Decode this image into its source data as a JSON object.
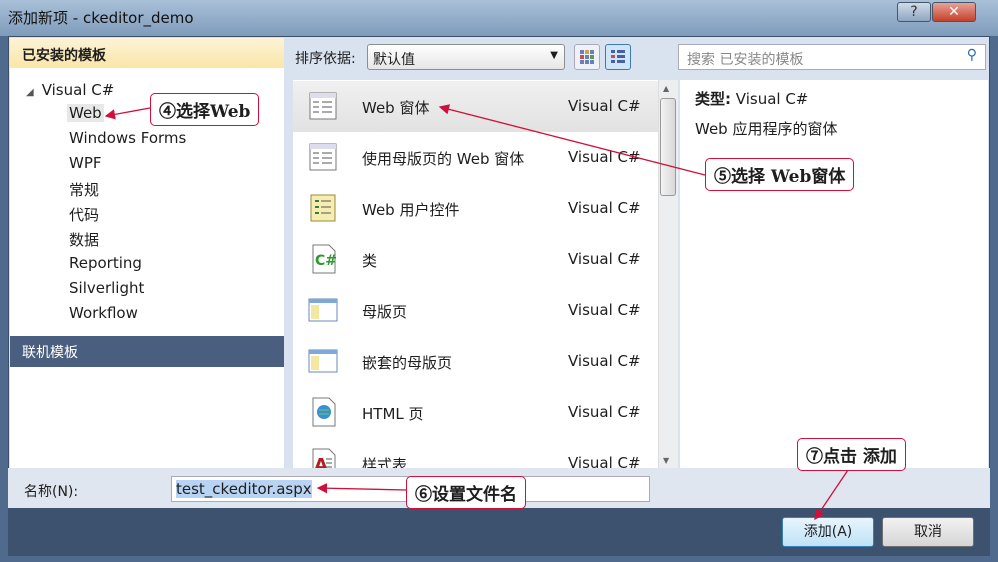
{
  "window": {
    "title": "添加新项 - ckeditor_demo",
    "help": "?",
    "close": "✕"
  },
  "left": {
    "header": "已安装的模板",
    "root": "Visual C#",
    "items": [
      "Web",
      "Windows Forms",
      "WPF",
      "常规",
      "代码",
      "数据",
      "Reporting",
      "Silverlight",
      "Workflow"
    ],
    "online": "联机模板"
  },
  "toolbar": {
    "sort_label": "排序依据:",
    "sort_value": "默认值",
    "search_placeholder": "搜索 已安装的模板"
  },
  "list": [
    {
      "name": "Web 窗体",
      "lang": "Visual C#",
      "icon": "web-form-icon"
    },
    {
      "name": "使用母版页的 Web 窗体",
      "lang": "Visual C#",
      "icon": "web-form-master-icon"
    },
    {
      "name": "Web 用户控件",
      "lang": "Visual C#",
      "icon": "user-control-icon"
    },
    {
      "name": "类",
      "lang": "Visual C#",
      "icon": "class-icon"
    },
    {
      "name": "母版页",
      "lang": "Visual C#",
      "icon": "master-page-icon"
    },
    {
      "name": "嵌套的母版页",
      "lang": "Visual C#",
      "icon": "nested-master-icon"
    },
    {
      "name": "HTML 页",
      "lang": "Visual C#",
      "icon": "html-page-icon"
    },
    {
      "name": "样式表",
      "lang": "Visual C#",
      "icon": "stylesheet-icon"
    }
  ],
  "details": {
    "type_label": "类型:",
    "type_value": "Visual C#",
    "description": "Web 应用程序的窗体"
  },
  "name": {
    "label": "名称(N):",
    "value": "test_ckeditor.aspx"
  },
  "buttons": {
    "add": "添加(A)",
    "cancel": "取消"
  },
  "annotations": {
    "n4": "④选择Web",
    "n5": "⑤选择 Web窗体",
    "n6": "⑥设置文件名",
    "n7": "⑦点击 添加",
    "color": "#d0103a"
  }
}
